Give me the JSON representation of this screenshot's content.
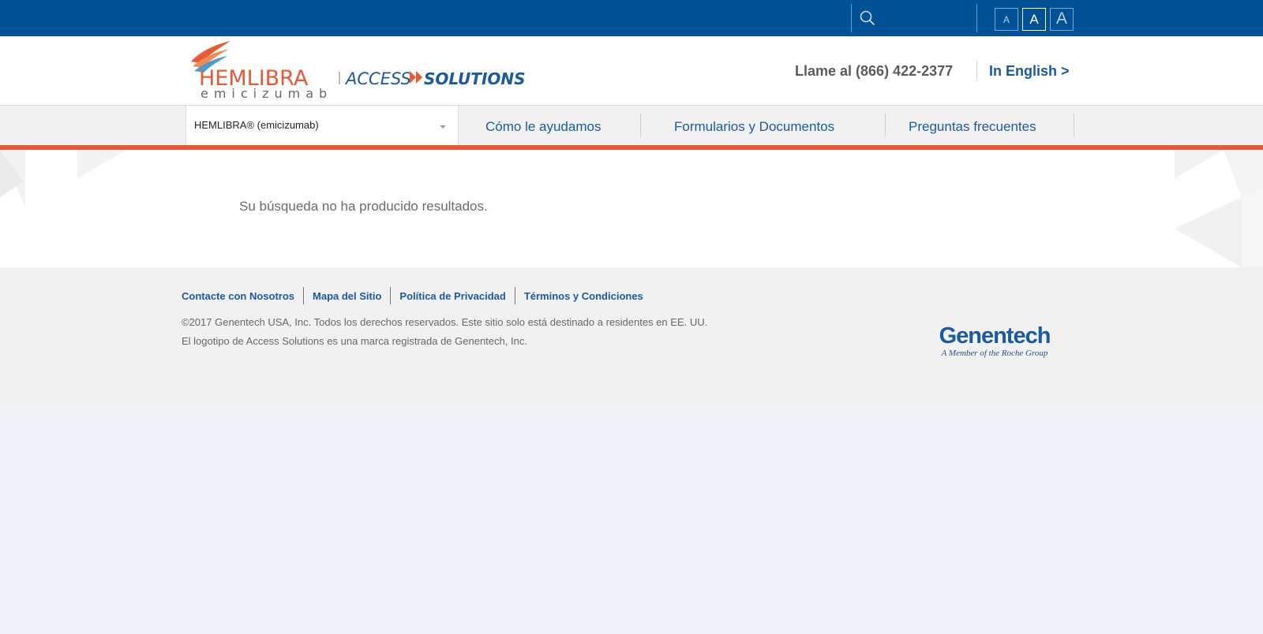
{
  "topbar": {
    "search_placeholder": "",
    "font_sizes": [
      "A",
      "A",
      "A"
    ]
  },
  "header": {
    "logo": {
      "brand": "HEMLIBRA",
      "generic": "emicizumab",
      "program_a": "ACCESS",
      "program_b": "SOLUTIONS"
    },
    "phone": "Llame al (866) 422-2377",
    "language_link": "In English >"
  },
  "nav": {
    "product_select": "HEMLIBRA® (emicizumab)",
    "items": [
      {
        "label": "Cómo le ayudamos"
      },
      {
        "label": "Formularios y Documentos"
      },
      {
        "label": "Preguntas frecuentes"
      }
    ]
  },
  "main": {
    "message": "Su búsqueda no ha producido resultados."
  },
  "footer": {
    "links": [
      {
        "label": "Contacte con Nosotros"
      },
      {
        "label": "Mapa del Sitio"
      },
      {
        "label": "Política de Privacidad"
      },
      {
        "label": "Términos y Condiciones"
      }
    ],
    "copyright": "©2017 Genentech USA, Inc. Todos los derechos reservados.  Este sitio solo está destinado a residentes en EE. UU.",
    "trademark": "El logotipo de Access Solutions es una marca registrada de Genentech, Inc.",
    "company": "Genentech",
    "company_tagline": "A Member of the Roche Group"
  },
  "colors": {
    "brand_blue": "#005195",
    "link_blue": "#1a5aa3",
    "accent_orange": "#e85a34"
  }
}
